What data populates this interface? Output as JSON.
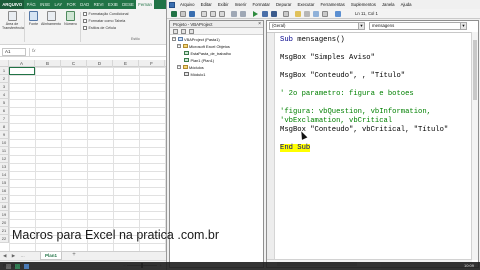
{
  "excel": {
    "tabs": [
      {
        "label": "ARQUIVO",
        "kind": "file"
      },
      {
        "label": "PÁG"
      },
      {
        "label": "INSE"
      },
      {
        "label": "LAY"
      },
      {
        "label": "FOR"
      },
      {
        "label": "DAD"
      },
      {
        "label": "REVI"
      },
      {
        "label": "EXIB"
      },
      {
        "label": "DESE"
      },
      {
        "label": "Fernan",
        "kind": "active"
      }
    ],
    "ribbon": {
      "btn_transform": "Área de Transferência",
      "btn_fonte": "Fonte",
      "btn_alinhamento": "Alinhamento",
      "btn_numero": "Número",
      "row_formatacao": "Formatação Condicional",
      "row_formatar_tabela": "Formatar como Tabela",
      "row_estilos": "Estilos de Célula",
      "group_label": "Estilo"
    },
    "name_box": "A1",
    "fx_label": "fx",
    "columns": [
      "A",
      "B",
      "C",
      "D",
      "E",
      "F"
    ],
    "rows": [
      "1",
      "2",
      "3",
      "4",
      "5",
      "6",
      "7",
      "8",
      "9",
      "10",
      "11",
      "12",
      "13",
      "14",
      "15",
      "16",
      "17",
      "18",
      "19",
      "20",
      "21",
      "22"
    ],
    "sheet_nav": "◀ ▶ …",
    "sheet_tab": "Plan1",
    "sheet_add": "+",
    "status": "PRONTO",
    "zoom_minus": "−",
    "zoom_plus": "+",
    "accent": "#217346"
  },
  "vbe": {
    "menus": [
      "Arquivo",
      "Editar",
      "Exibir",
      "Inserir",
      "Formatar",
      "Depurar",
      "Executar",
      "Ferramentas",
      "Suplementos",
      "Janela",
      "Ajuda"
    ],
    "cursor_pos": "Ln 11, Col 1",
    "explorer_title": "Projeto - VBAProject",
    "explorer_close": "×",
    "tree": [
      {
        "label": "VBAProject (Pasta1)",
        "exp": "−",
        "icon": "project"
      },
      {
        "label": "Microsoft Excel Objetos",
        "exp": "−",
        "icon": "folder"
      },
      {
        "label": "EstaPasta_de_trabalho",
        "icon": "sheet"
      },
      {
        "label": "Plan1 (Plan1)",
        "icon": "sheet"
      },
      {
        "label": "Módulos",
        "exp": "−",
        "icon": "folder"
      },
      {
        "label": "Módulo1",
        "icon": "module"
      }
    ],
    "combo_left": "(Geral)",
    "combo_right": "mensagens",
    "combo_arrow": "▼",
    "code": [
      [
        {
          "t": "Sub",
          "c": "kw"
        },
        {
          "t": " mensagens()"
        }
      ],
      [],
      [
        {
          "t": "MsgBox \"Simples Aviso\""
        }
      ],
      [],
      [
        {
          "t": "MsgBox \"Conteudo\", , \"Título\""
        }
      ],
      [],
      [
        {
          "t": "' 2o parametro: figura e botoes",
          "c": "cm"
        }
      ],
      [],
      [
        {
          "t": "'figura: vbQuestion, vbInformation,",
          "c": "cm"
        }
      ],
      [
        {
          "t": "'vbExclamation, vbCritical",
          "c": "cm"
        }
      ],
      [
        {
          "t": "MsgBox \"Conteudo\", vbCritical, \"Título\""
        }
      ],
      [],
      [
        {
          "t": "End Sub",
          "c": "sel"
        }
      ]
    ],
    "keyword_color": "#00008b",
    "comment_color": "#008000"
  },
  "watermark": "Macros para Excel na pratica .com.br",
  "taskbar": {
    "time": "10:09"
  }
}
